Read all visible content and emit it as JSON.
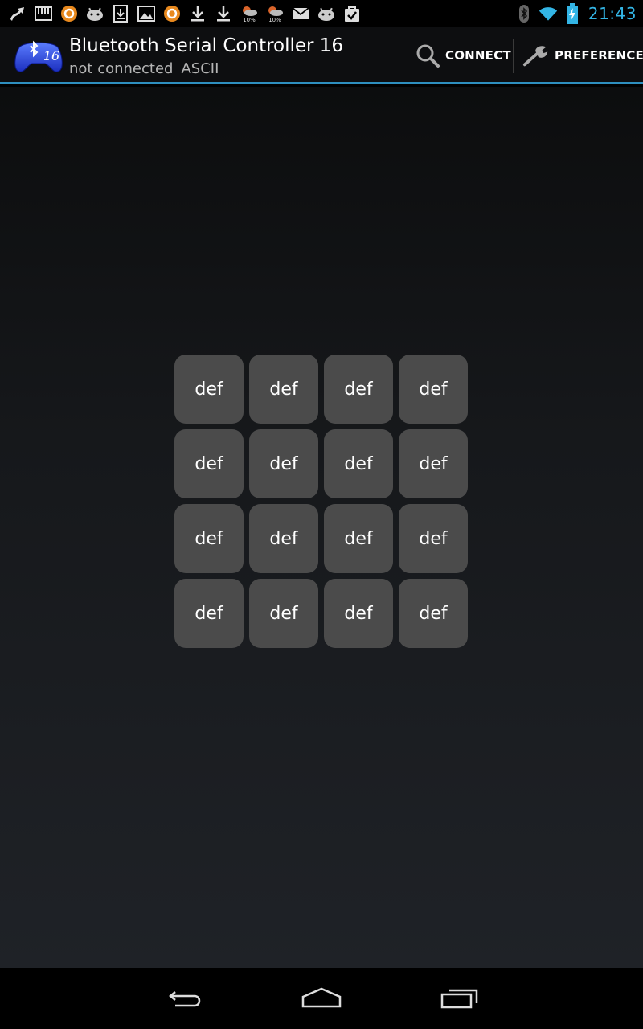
{
  "status_bar": {
    "time": "21:43",
    "notification_icons": [
      "route-icon",
      "piano-icon",
      "orange-circle-icon",
      "android-icon",
      "sd-download-icon",
      "image-icon",
      "orange-circle-icon",
      "download-icon",
      "download-icon",
      "weather-icon",
      "weather-icon",
      "mail-icon",
      "android-icon",
      "shopping-bag-icon"
    ],
    "weather_percent_1": "10%",
    "weather_percent_2": "10%"
  },
  "action_bar": {
    "app_icon_badge": "16",
    "title": "Bluetooth Serial Controller 16",
    "status": "not connected",
    "mode": "ASCII",
    "connect_label": "CONNECT",
    "preference_label": "PREFERENCE"
  },
  "pad": {
    "buttons": [
      "def",
      "def",
      "def",
      "def",
      "def",
      "def",
      "def",
      "def",
      "def",
      "def",
      "def",
      "def",
      "def",
      "def",
      "def",
      "def"
    ]
  },
  "colors": {
    "accent": "#33b5e5",
    "action_bar_border": "#2e8fbf",
    "button_bg": "#4b4b4b"
  }
}
